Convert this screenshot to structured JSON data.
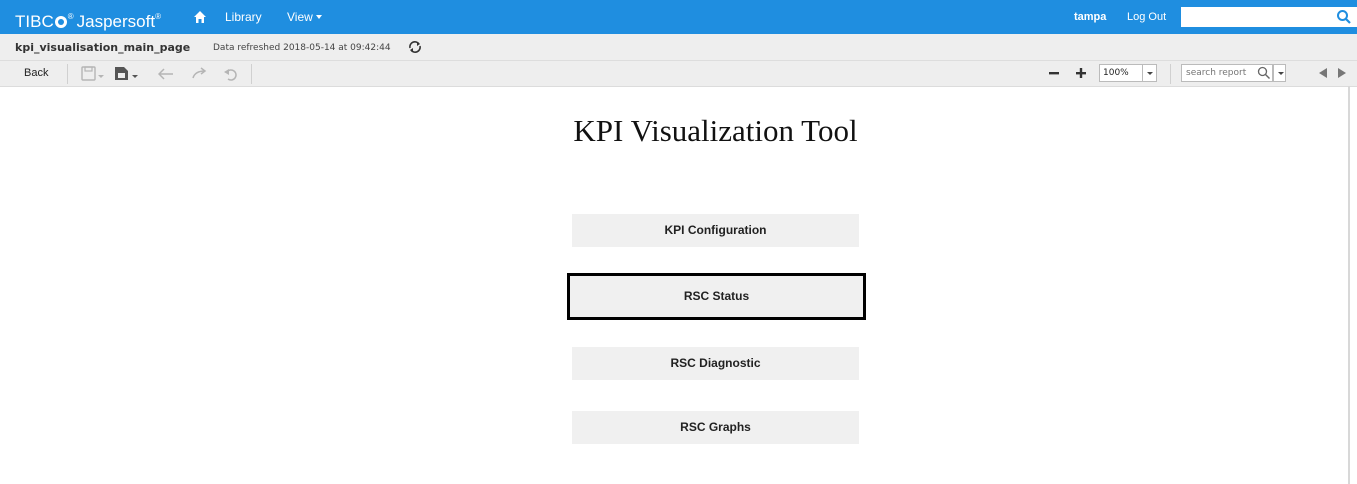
{
  "topbar": {
    "logo_text": "TIBC",
    "logo_text_2": "Jaspersoft",
    "logo_tm": "®",
    "logo_tm_2": "®",
    "nav": {
      "library": "Library",
      "view": "View"
    },
    "user": "tampa",
    "logout": "Log Out",
    "search_value": ""
  },
  "titlebar": {
    "report_name": "kpi_visualisation_main_page",
    "refreshed": "Data refreshed 2018-05-14 at 09:42:44"
  },
  "toolbar": {
    "back_label": "Back",
    "zoom_value": "100%",
    "search_placeholder": "search report"
  },
  "main": {
    "title": "KPI Visualization Tool",
    "buttons": [
      {
        "label": "KPI Configuration"
      },
      {
        "label": "RSC Status",
        "selected": true
      },
      {
        "label": "RSC Diagnostic"
      },
      {
        "label": "RSC Graphs"
      }
    ]
  },
  "colors": {
    "accent": "#1f8ee0",
    "toolbar_bg": "#eeeeee",
    "button_bg": "#f0f0f0"
  },
  "icons": [
    "home-icon",
    "search-icon",
    "refresh-icon",
    "save-icon",
    "export-icon",
    "undo-icon",
    "redo-icon",
    "undo-all-icon",
    "zoom-out-icon",
    "zoom-in-icon",
    "previous-page-icon",
    "next-page-icon"
  ]
}
